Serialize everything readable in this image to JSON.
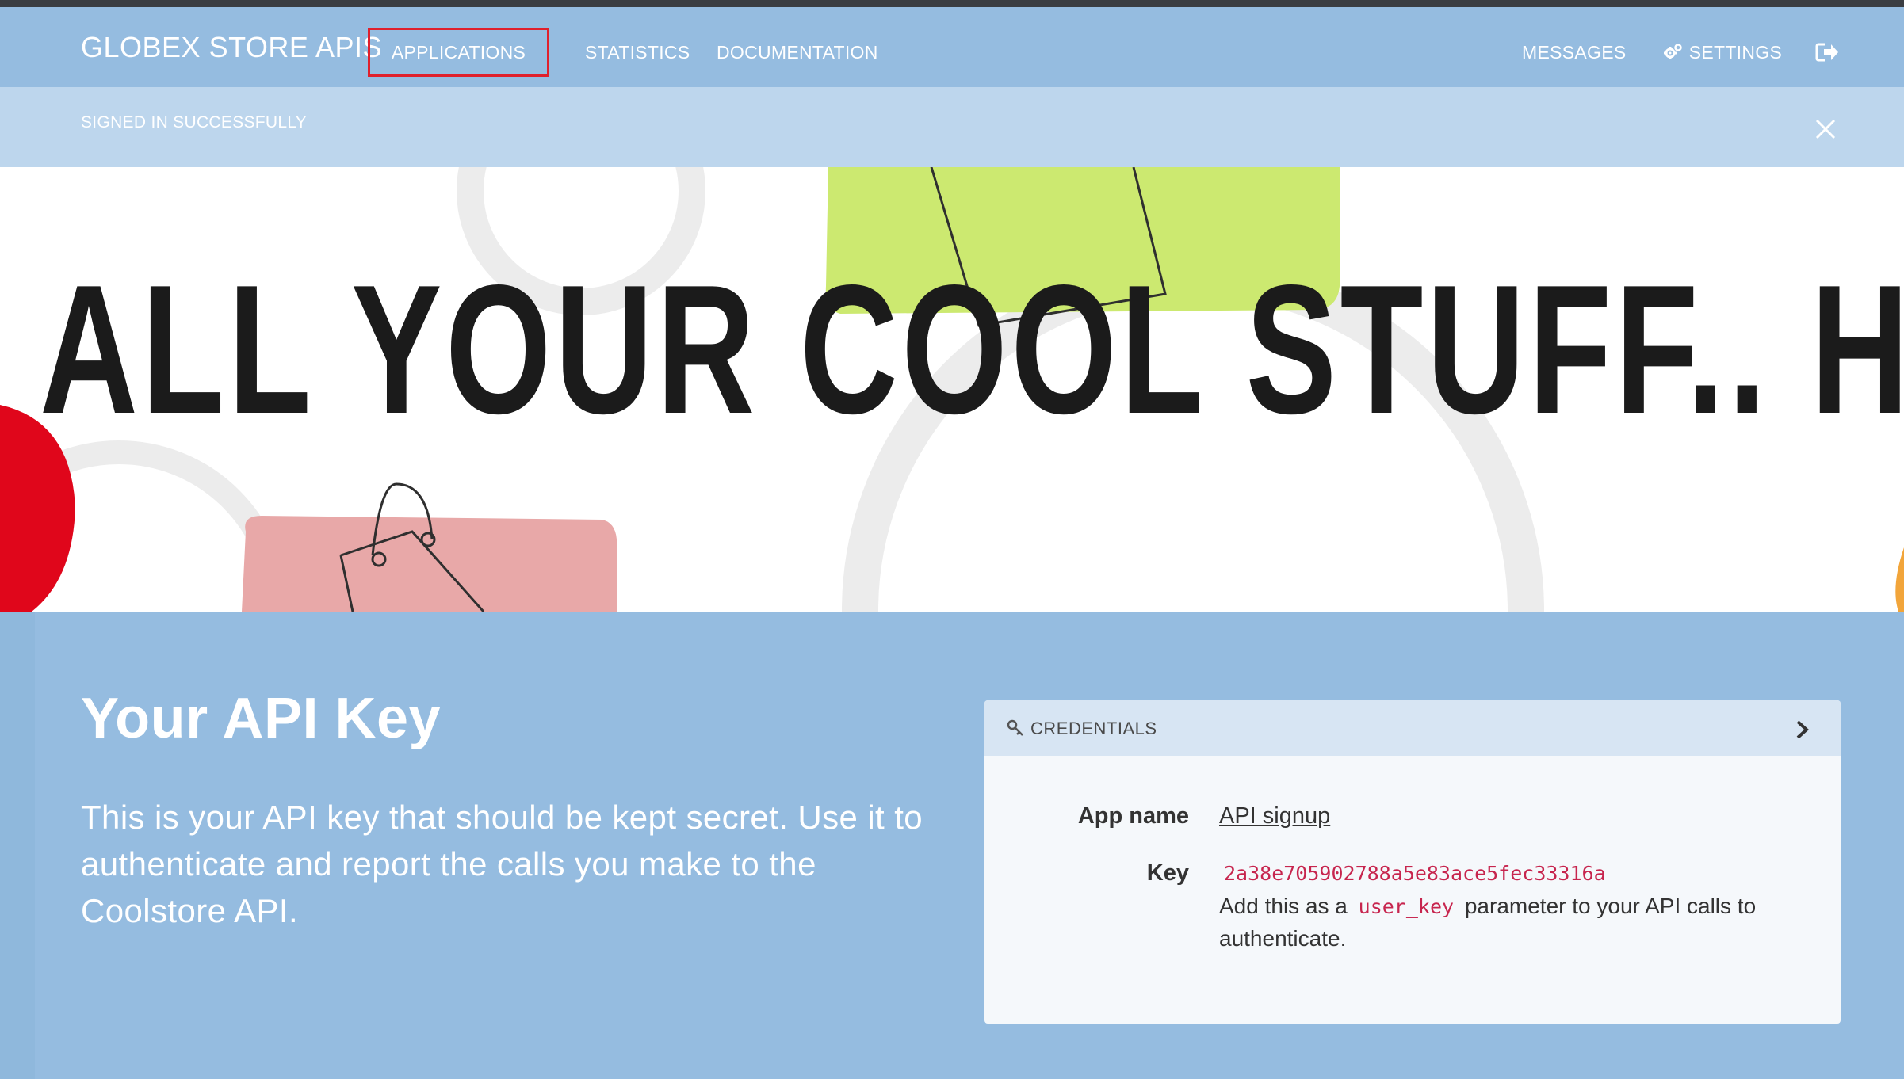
{
  "navbar": {
    "brand": "GLOBEX STORE APIS",
    "items": {
      "applications": "APPLICATIONS",
      "statistics": "STATISTICS",
      "documentation": "DOCUMENTATION",
      "messages": "MESSAGES",
      "settings": "SETTINGS"
    }
  },
  "notice": {
    "text": "SIGNED IN SUCCESSFULLY"
  },
  "hero": {
    "text": "ALL YOUR COOL STUFF.. HERE"
  },
  "main": {
    "title": "Your API Key",
    "description": "This is your API key that should be kept secret. Use it to authenticate and report the calls you make to the Coolstore API."
  },
  "credentials": {
    "header": "CREDENTIALS",
    "app_name_label": "App name",
    "app_name_value": "API signup",
    "key_label": "Key",
    "key_value": "2a38e705902788a5e83ace5fec33316a",
    "help_prefix": "Add this as a",
    "help_code": "user_key",
    "help_suffix": "parameter to your API calls to authenticate."
  },
  "colors": {
    "primary": "#95bce0",
    "notice_bg": "#bdd6ed",
    "highlight_border": "#e0202c",
    "code": "#c7254e"
  }
}
